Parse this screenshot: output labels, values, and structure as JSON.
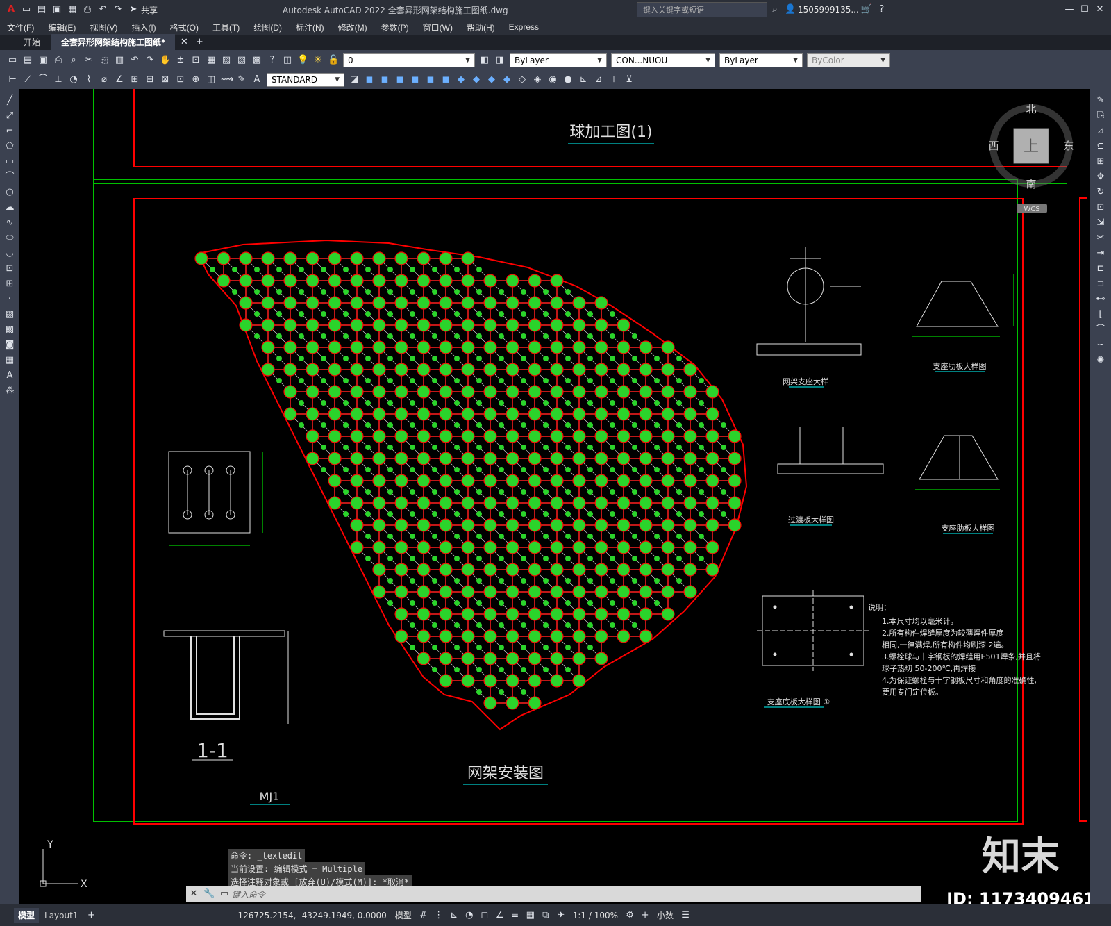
{
  "window": {
    "title": "Autodesk AutoCAD 2022    全套异形网架结构施工图纸.dwg",
    "share_label": "共享",
    "search_placeholder": "键入关键字或短语",
    "user": "1505999135..."
  },
  "menu": [
    "文件(F)",
    "编辑(E)",
    "视图(V)",
    "插入(I)",
    "格式(O)",
    "工具(T)",
    "绘图(D)",
    "标注(N)",
    "修改(M)",
    "参数(P)",
    "窗口(W)",
    "帮助(H)",
    "Express"
  ],
  "tabs": [
    {
      "label": "开始",
      "active": false
    },
    {
      "label": "全套异形网架结构施工图纸*",
      "active": true
    }
  ],
  "toolbar": {
    "layer_value": "0",
    "text_style": "STANDARD",
    "color": "ByLayer",
    "linetype": "CON...NUOU",
    "lineweight": "ByLayer",
    "plotstyle": "ByColor"
  },
  "viewcube": {
    "north": "北",
    "south": "南",
    "east": "东",
    "west": "西",
    "face": "上",
    "wcs": "WCS"
  },
  "drawing": {
    "title_top": "球加工图(1)",
    "title_main": "网架安装图",
    "support_detail": "网架支座大样",
    "rib_detail_1": "支座肋板大样图",
    "rib_detail_2": "支座肋板大样图",
    "transition_plate": "过渡板大样图",
    "base_plate": "支座底板大样图 ①",
    "section_label": "1-1",
    "mj_label": "MJ1",
    "notes_title": "说明：",
    "notes": [
      "1.本尺寸均以毫米计。",
      "2.所有构件焊缝厚度为较薄焊件厚度",
      "  相同,一律满焊,所有构件均刷漆 2遍。",
      "3.螺栓球与十字钢板的焊缝用E501焊条,并且将",
      "  球子热切  50-200℃,再焊接",
      "4.为保证螺栓与十字钢板尺寸和角度的准确性,",
      "  要用专门定位板。"
    ]
  },
  "command_history": [
    "命令: _textedit",
    "当前设置: 编辑模式 = Multiple",
    "选择注释对象或 [放弃(U)/模式(M)]: *取消*"
  ],
  "command_placeholder": "键入命令",
  "layout_tabs": [
    "模型",
    "Layout1"
  ],
  "status": {
    "coords": "126725.2154, -43249.1949, 0.0000",
    "model": "模型",
    "scale": "1:1 / 100%",
    "units": "小数"
  },
  "watermark": {
    "brand": "知末",
    "id": "ID: 1173409461"
  },
  "colors": {
    "frame_red": "#ff0000",
    "grid_green": "#00ff00",
    "node_green": "#2bd42b",
    "bg": "#000000"
  }
}
